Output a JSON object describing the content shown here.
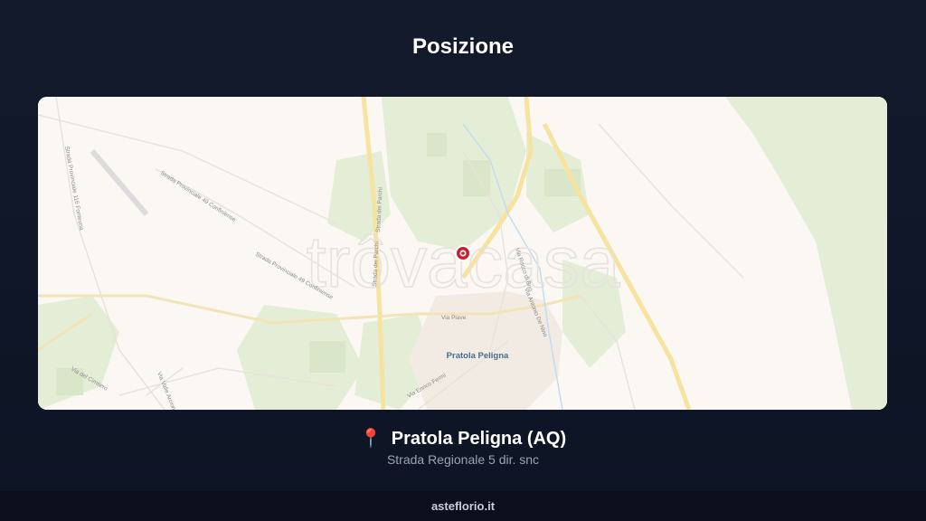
{
  "page": {
    "title": "Posizione"
  },
  "map": {
    "watermark": "trôvacasa",
    "town_label": "Pratola Peligna",
    "street_labels": [
      "Strada Provinciale 49 Confiniense",
      "Strada Provinciale 49 Confiniense",
      "Strada Provinciale 116 Fonteuna",
      "Strada dei Parchi",
      "Strada dei Parchi",
      "Via Piave",
      "Via Enrico Fermi",
      "Via del Cimitero",
      "Via Valle Arcione",
      "Via Antonio De Nino",
      "Via Rocco di Brio"
    ],
    "marker_icon": "location-marker-icon",
    "colors": {
      "land": "#fbf8f4",
      "green": "#e3edd5",
      "highway": "#f6e3a0",
      "marker": "#c8202f"
    }
  },
  "location": {
    "pin_icon": "📍",
    "name": "Pratola Peligna (AQ)",
    "address": "Strada Regionale 5 dir. snc"
  },
  "footer": {
    "site": "asteflorio.it"
  }
}
